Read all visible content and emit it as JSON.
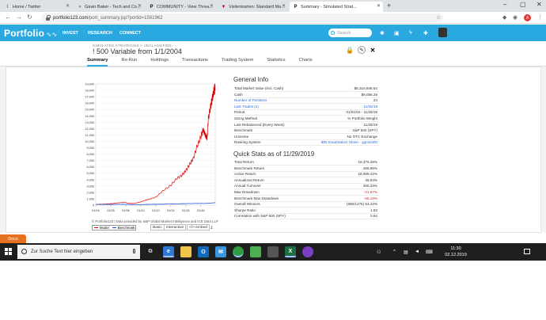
{
  "browser": {
    "tabs": [
      {
        "title": "Home / Twitter",
        "icon": "twitter-icon",
        "color": "#1da1f2",
        "left": 2,
        "width": 89
      },
      {
        "title": "Gavin Baker - Tech and Co...",
        "icon": "incognito-icon",
        "color": "#555555",
        "left": 93,
        "width": 89
      },
      {
        "title": "COMMUNITY - View Threa...",
        "icon": "portfolio123-icon",
        "color": "#111111",
        "left": 184,
        "width": 89
      },
      {
        "title": "Visitenkarten: Standard Ma...",
        "icon": "vistaprint-icon",
        "color": "#cc0000",
        "left": 275,
        "width": 89
      },
      {
        "title": "Summary - Simulated Strat...",
        "icon": "portfolio123-icon",
        "color": "#111111",
        "left": 366,
        "width": 118,
        "active": true
      }
    ],
    "url_host": "portfolio123.com",
    "url_path": "/port_summary.jsp?portid=1591962",
    "profile_letter": "A"
  },
  "site": {
    "logo": "Portfolio",
    "nav": [
      "INVEST",
      "RESEARCH",
      "CONNECT"
    ],
    "search_placeholder": "Search"
  },
  "strategy": {
    "breadcrumb": "SIMULATED STRATEGIES > UNCLASSIFIED",
    "title": "! 500 Variable from 1/1/2004",
    "tabs": [
      "Summary",
      "Re-Run",
      "Holdings",
      "Transactions",
      "Trading System",
      "Statistics",
      "Charts"
    ],
    "active_tab": "Summary"
  },
  "general_info": {
    "title": "General Info",
    "rows": [
      {
        "k": "Total Market Value (incl. Cash)",
        "v": "$5,316,946.64"
      },
      {
        "k": "Cash",
        "v": "$9,056.26"
      },
      {
        "k": "Number of Positions",
        "v": "24",
        "klink": true
      },
      {
        "k": "Last Trades (4)",
        "v": "11/25/19",
        "klink": true,
        "vlink": true
      },
      {
        "k": "Period",
        "v": "01/01/04 - 11/25/19"
      },
      {
        "k": "Sizing Method",
        "v": "% Portfolio Weight"
      },
      {
        "k": "Last Rebalanced (Every Week)",
        "v": "11/25/19"
      },
      {
        "k": "Benchmark",
        "v": "S&P 500 (SPY)"
      },
      {
        "k": "Universe",
        "v": "No OTC Exchange"
      },
      {
        "k": "Ranking System",
        "v": "IBD SmartSelect Gleen - gqmix500",
        "vlink": true
      }
    ]
  },
  "quick_stats": {
    "title": "Quick Stats as of 11/29/2019",
    "rows": [
      {
        "k": "Total Return",
        "v": "18,376.38%"
      },
      {
        "k": "Benchmark Return",
        "v": "286.96%"
      },
      {
        "k": "Active Return",
        "v": "18,089.42%"
      },
      {
        "k": "Annualized Return",
        "v": "38.83%"
      },
      {
        "k": "Annual Turnover",
        "v": "305.33%"
      },
      {
        "k": "Max Drawdown",
        "v": "-21.87%",
        "neg": true
      },
      {
        "k": "Benchmark Max Drawdown",
        "v": "-55.19%",
        "neg": true
      },
      {
        "k": "Overall Winners",
        "v": "(680/1275) 53.42%"
      },
      {
        "k": "Sharpe Ratio",
        "v": "1.83"
      },
      {
        "k": "Correlation with S&P 500 (SPY)",
        "v": "0.54"
      }
    ]
  },
  "chart_controls": {
    "credit": "© Portfolio123 | Data provided by S&P Global Market Intelligence and ICE Data LLP",
    "legend_model": "Model",
    "legend_benchmark": "Benchmark",
    "btn_basic": "Basic",
    "btn_interactive": "Interactive",
    "btn_embed": "</> embed"
  },
  "chart_data": {
    "type": "line",
    "yticks": [
      "0",
      "1,000",
      "2,000",
      "3,000",
      "4,000",
      "5,000",
      "6,000",
      "7,000",
      "8,000",
      "9,000",
      "10,000",
      "11,000",
      "12,000",
      "13,000",
      "14,000",
      "15,000",
      "16,000",
      "17,000",
      "18,000",
      "19,000"
    ],
    "ylim": [
      0,
      19000
    ],
    "xticks": [
      "01/04",
      "01/06",
      "01/08",
      "01/10",
      "01/12",
      "01/14",
      "01/16",
      "01/18"
    ],
    "xlim": [
      2004.0,
      2019.92
    ],
    "series": [
      {
        "name": "Model",
        "color": "#e00000",
        "points": [
          [
            2004.0,
            100
          ],
          [
            2005.0,
            160
          ],
          [
            2006.0,
            230
          ],
          [
            2007.0,
            360
          ],
          [
            2007.8,
            440
          ],
          [
            2008.5,
            270
          ],
          [
            2009.2,
            280
          ],
          [
            2010.0,
            520
          ],
          [
            2011.0,
            900
          ],
          [
            2012.0,
            1250
          ],
          [
            2013.0,
            2300
          ],
          [
            2014.0,
            3100
          ],
          [
            2014.8,
            4200
          ],
          [
            2015.5,
            4700
          ],
          [
            2016.0,
            5400
          ],
          [
            2016.5,
            6400
          ],
          [
            2017.0,
            7300
          ],
          [
            2017.5,
            9200
          ],
          [
            2018.0,
            10700
          ],
          [
            2018.3,
            11800
          ],
          [
            2018.6,
            11000
          ],
          [
            2018.85,
            10500
          ],
          [
            2019.0,
            13500
          ],
          [
            2019.3,
            15500
          ],
          [
            2019.55,
            16800
          ],
          [
            2019.75,
            18000
          ],
          [
            2019.92,
            18376
          ]
        ]
      },
      {
        "name": "Benchmark",
        "color": "#1f4fd6",
        "points": [
          [
            2004.0,
            100
          ],
          [
            2006.0,
            115
          ],
          [
            2007.8,
            130
          ],
          [
            2009.2,
            75
          ],
          [
            2011.0,
            120
          ],
          [
            2013.0,
            150
          ],
          [
            2015.0,
            210
          ],
          [
            2017.0,
            260
          ],
          [
            2018.8,
            270
          ],
          [
            2019.92,
            387
          ]
        ]
      }
    ]
  },
  "docs_label": "Docs",
  "taskbar": {
    "search_placeholder": "Zur Suche Text hier eingeben",
    "time": "11:30",
    "date": "02.12.2019"
  }
}
